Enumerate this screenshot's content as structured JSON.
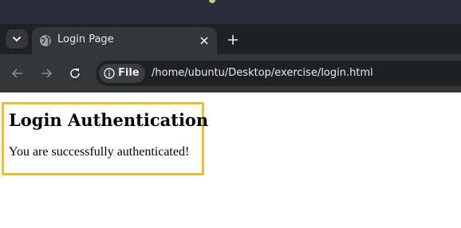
{
  "tab": {
    "title": "Login Page"
  },
  "address_bar": {
    "chip_label": "File",
    "url": "/home/ubuntu/Desktop/exercise/login.html"
  },
  "page": {
    "heading": "Login Authentication",
    "message": "You are successfully authenticated!"
  },
  "icons": {
    "tab_search": "chevron-down-icon",
    "favicon": "globe-icon",
    "close": "close-icon",
    "new_tab": "plus-icon",
    "back": "arrow-left-icon",
    "forward": "arrow-right-icon",
    "reload": "reload-icon",
    "info": "info-icon"
  },
  "colors": {
    "accent_border": "#f0be2c",
    "browser_frame": "#35363a",
    "tabstrip": "#1f2023"
  }
}
